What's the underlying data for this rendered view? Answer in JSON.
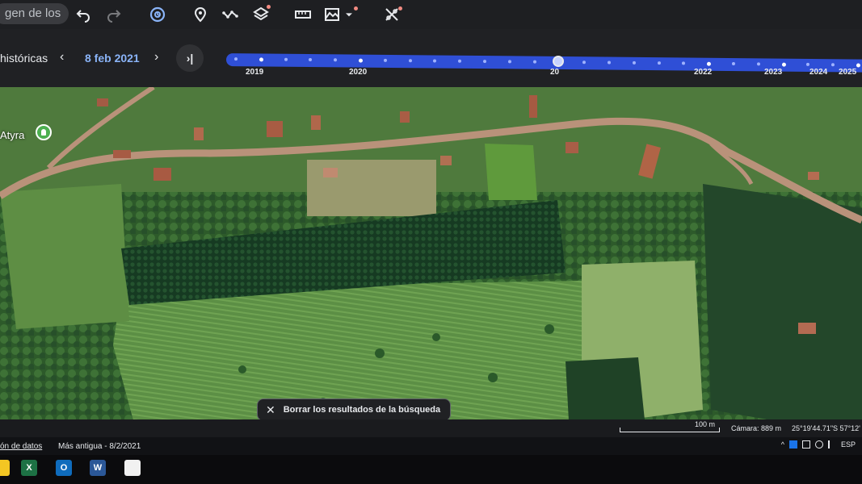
{
  "toolbar": {
    "search_chip_text": "gen de los",
    "icons": [
      "undo-icon",
      "redo-icon",
      "historical-imagery-icon",
      "placemark-icon",
      "path-icon",
      "layers-icon",
      "ruler-icon",
      "elevation-profile-icon",
      "imagery-settings-icon"
    ]
  },
  "timeline": {
    "label": "históricas",
    "prev_symbol": "‹",
    "next_symbol": "›",
    "current_date": "8 feb 2021",
    "latest_symbol": "›|",
    "years": [
      "2019",
      "2020",
      "20",
      "2022",
      "2023",
      "2024",
      "2025"
    ],
    "selected_fraction": 0.52
  },
  "map": {
    "place_label": "Atyra",
    "clear_results": "Borrar los resultados de la búsqueda",
    "view_mode": "2D"
  },
  "status": {
    "scale": "100 m",
    "camera": "Cámara: 889 m",
    "coordinates": "25°19'44.71\"S 57°12'"
  },
  "infobar": {
    "data_source": "ón de datos",
    "oldest": "Más antigua - 8/2/2021",
    "language": "ESP",
    "tray_up": "^"
  },
  "colors": {
    "track": "#2f4fd6",
    "date": "#8ab4f8",
    "toolbar": "#1e1f22"
  }
}
